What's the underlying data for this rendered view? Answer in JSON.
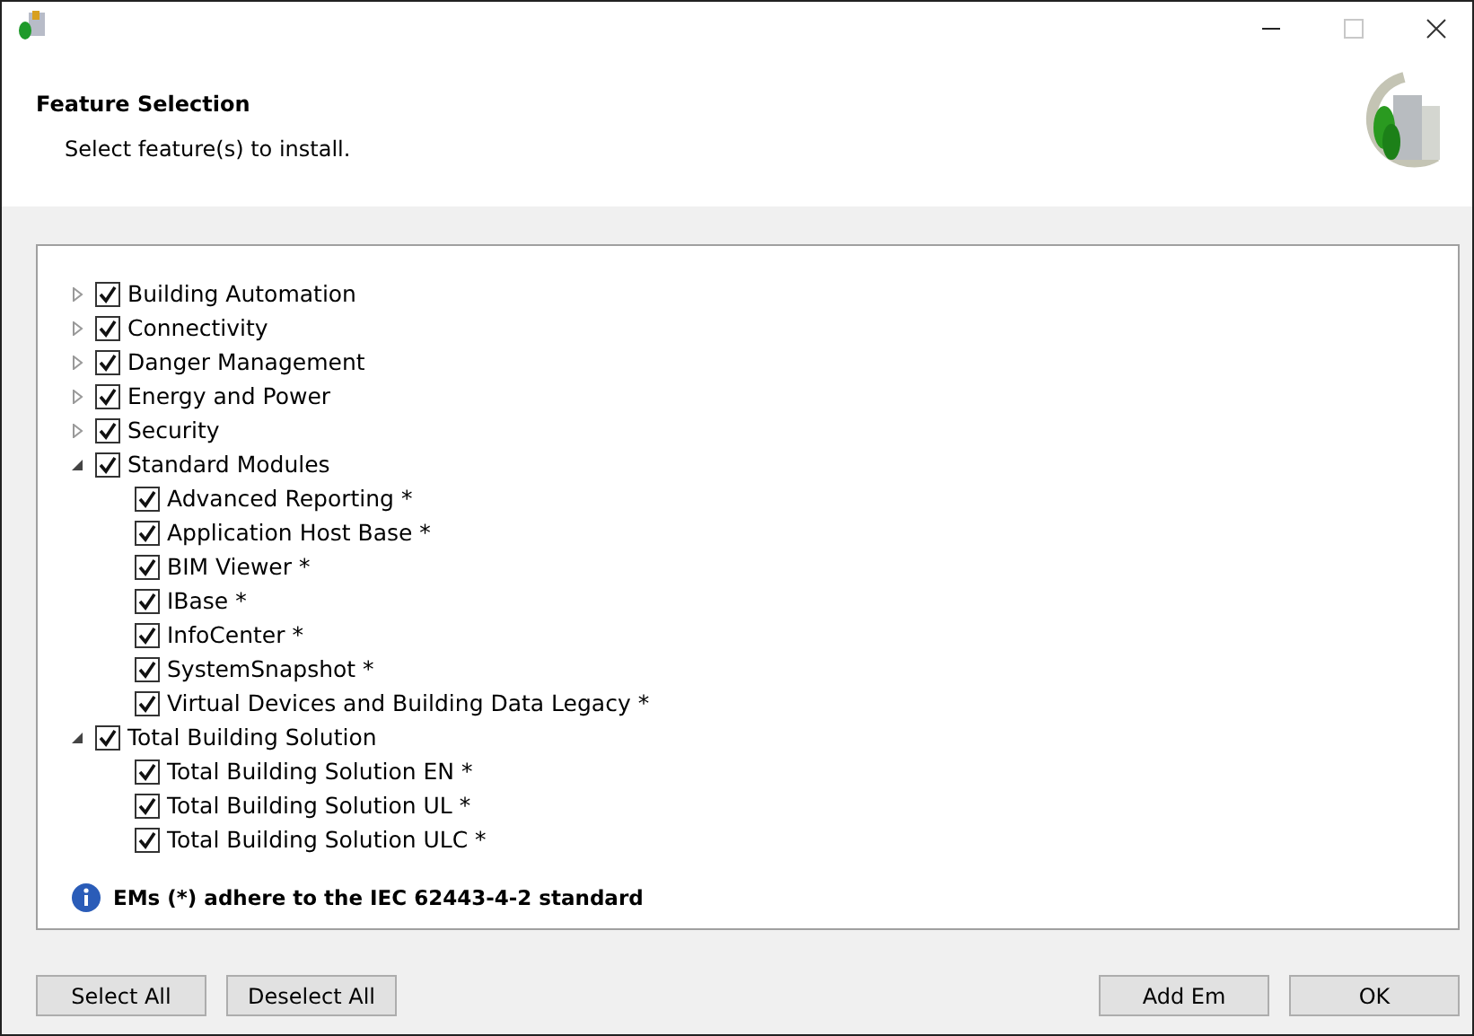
{
  "window": {
    "maximize_disabled": true
  },
  "header": {
    "title": "Feature Selection",
    "subtitle": "Select feature(s) to install."
  },
  "features": [
    {
      "label": "Building Automation",
      "checked": true,
      "expanded": false
    },
    {
      "label": "Connectivity",
      "checked": true,
      "expanded": false
    },
    {
      "label": "Danger Management",
      "checked": true,
      "expanded": false
    },
    {
      "label": "Energy and Power",
      "checked": true,
      "expanded": false
    },
    {
      "label": "Security",
      "checked": true,
      "expanded": false
    },
    {
      "label": "Standard Modules",
      "checked": true,
      "expanded": true,
      "children": [
        {
          "label": "Advanced Reporting *",
          "checked": true
        },
        {
          "label": "Application Host Base *",
          "checked": true
        },
        {
          "label": "BIM Viewer *",
          "checked": true
        },
        {
          "label": "IBase *",
          "checked": true
        },
        {
          "label": "InfoCenter *",
          "checked": true
        },
        {
          "label": "SystemSnapshot *",
          "checked": true
        },
        {
          "label": "Virtual Devices and Building Data Legacy *",
          "checked": true
        }
      ]
    },
    {
      "label": "Total Building Solution",
      "checked": true,
      "expanded": true,
      "children": [
        {
          "label": "Total Building Solution EN *",
          "checked": true
        },
        {
          "label": "Total Building Solution UL *",
          "checked": true
        },
        {
          "label": "Total Building Solution ULC *",
          "checked": true
        }
      ]
    }
  ],
  "note": "EMs (*) adhere to the IEC 62443-4-2 standard",
  "buttons_left": [
    "Select All",
    "Deselect All"
  ],
  "buttons_right": [
    "Add Em",
    "OK"
  ]
}
